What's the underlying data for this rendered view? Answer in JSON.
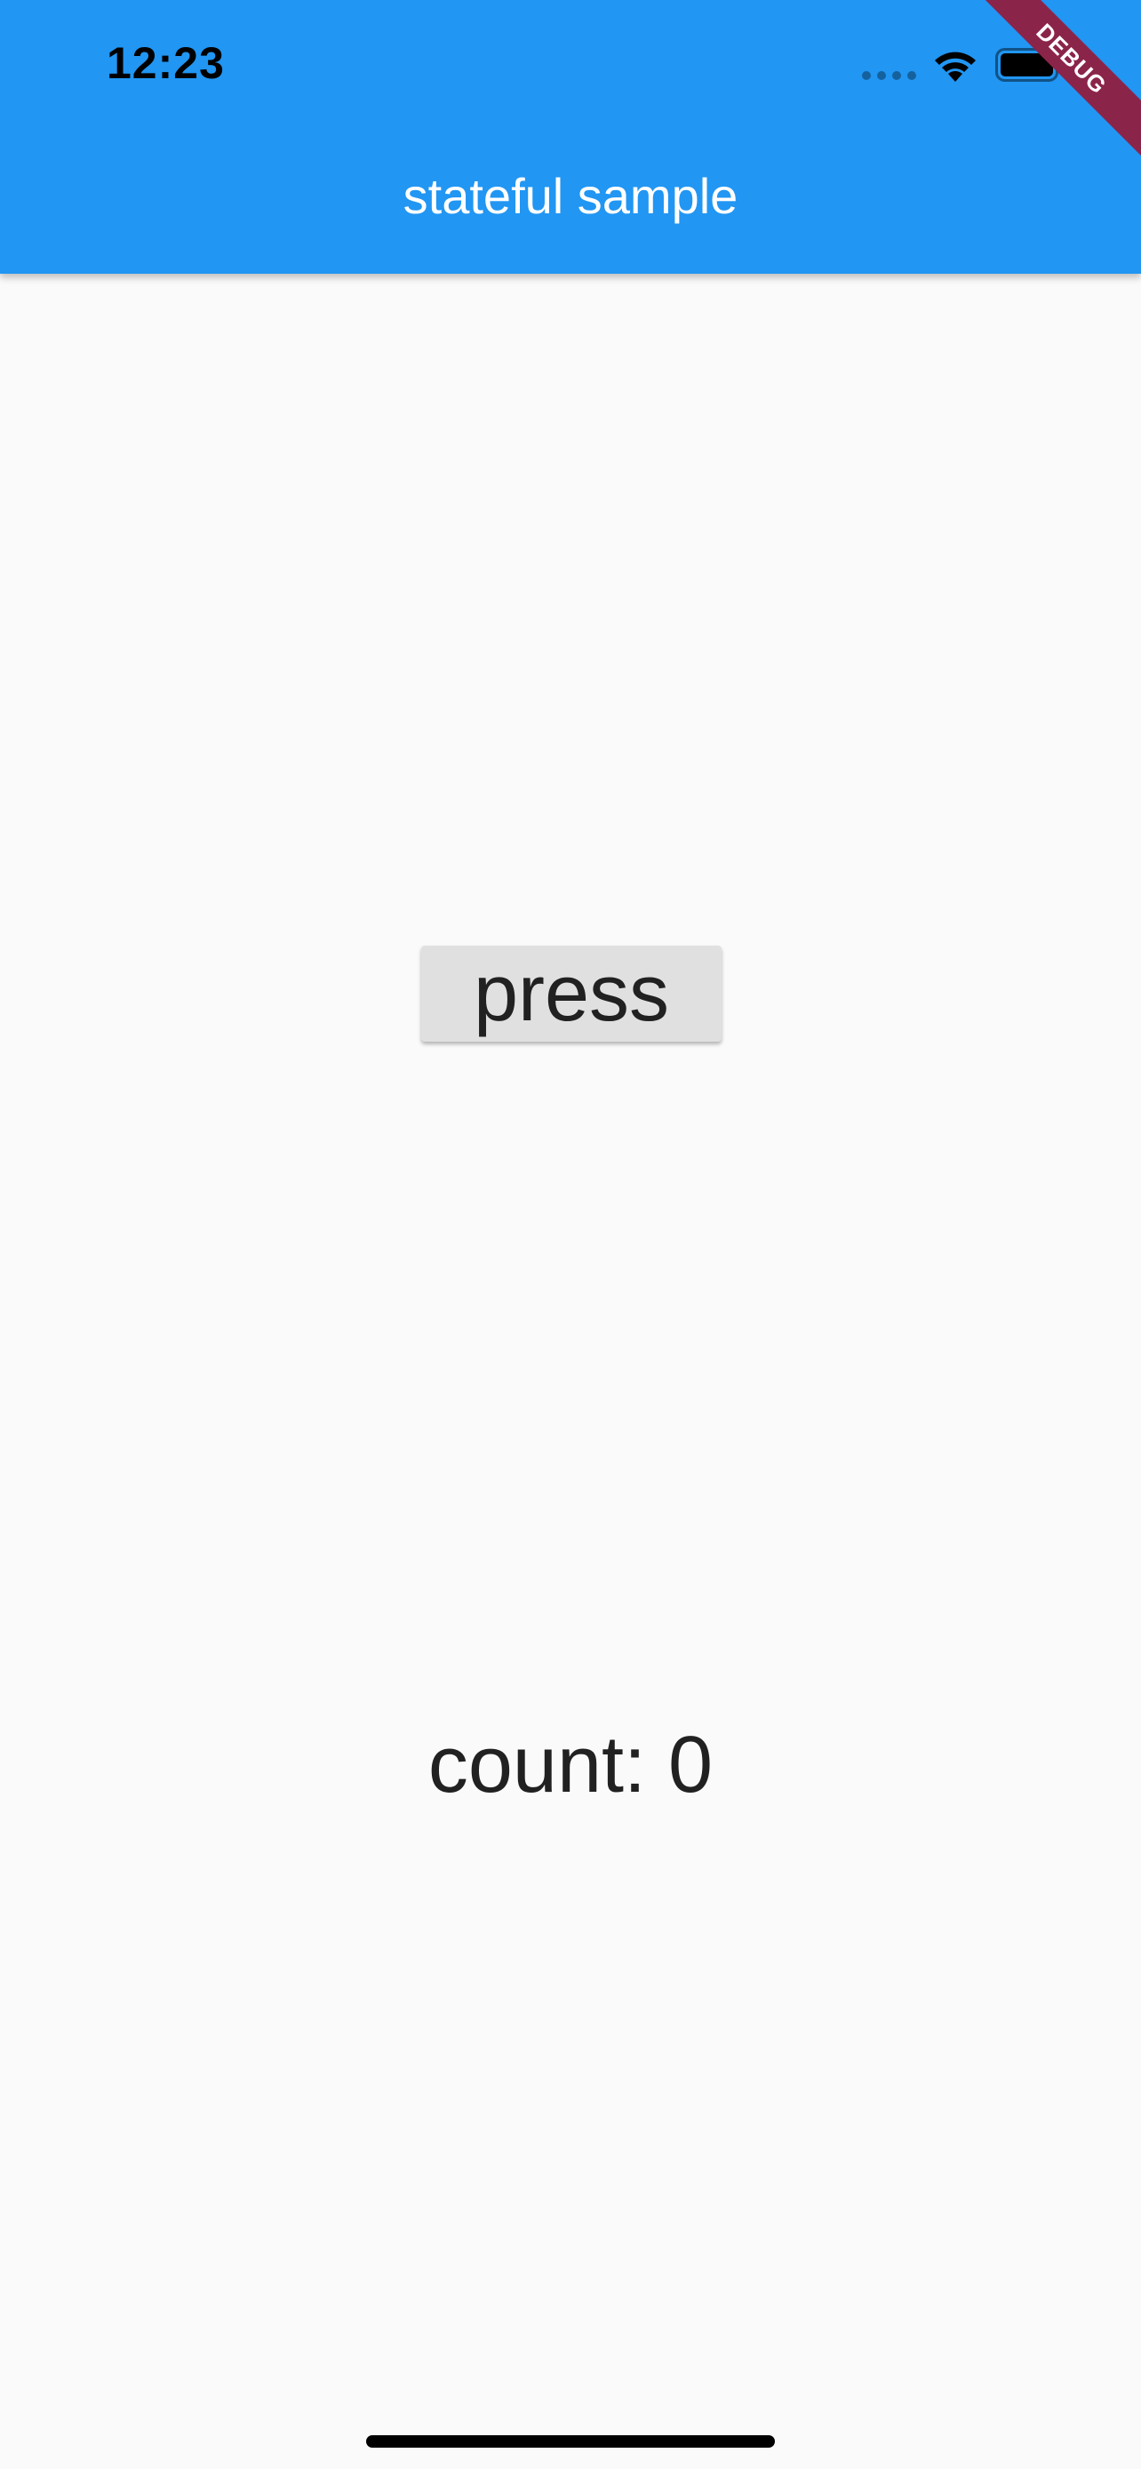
{
  "status_bar": {
    "time": "12:23"
  },
  "app_bar": {
    "title": "stateful sample",
    "background": "#2196f3"
  },
  "debug_banner": {
    "label": "DEBUG",
    "color": "#8b2449"
  },
  "main": {
    "button_label": "press",
    "count_text": "count: 0"
  }
}
